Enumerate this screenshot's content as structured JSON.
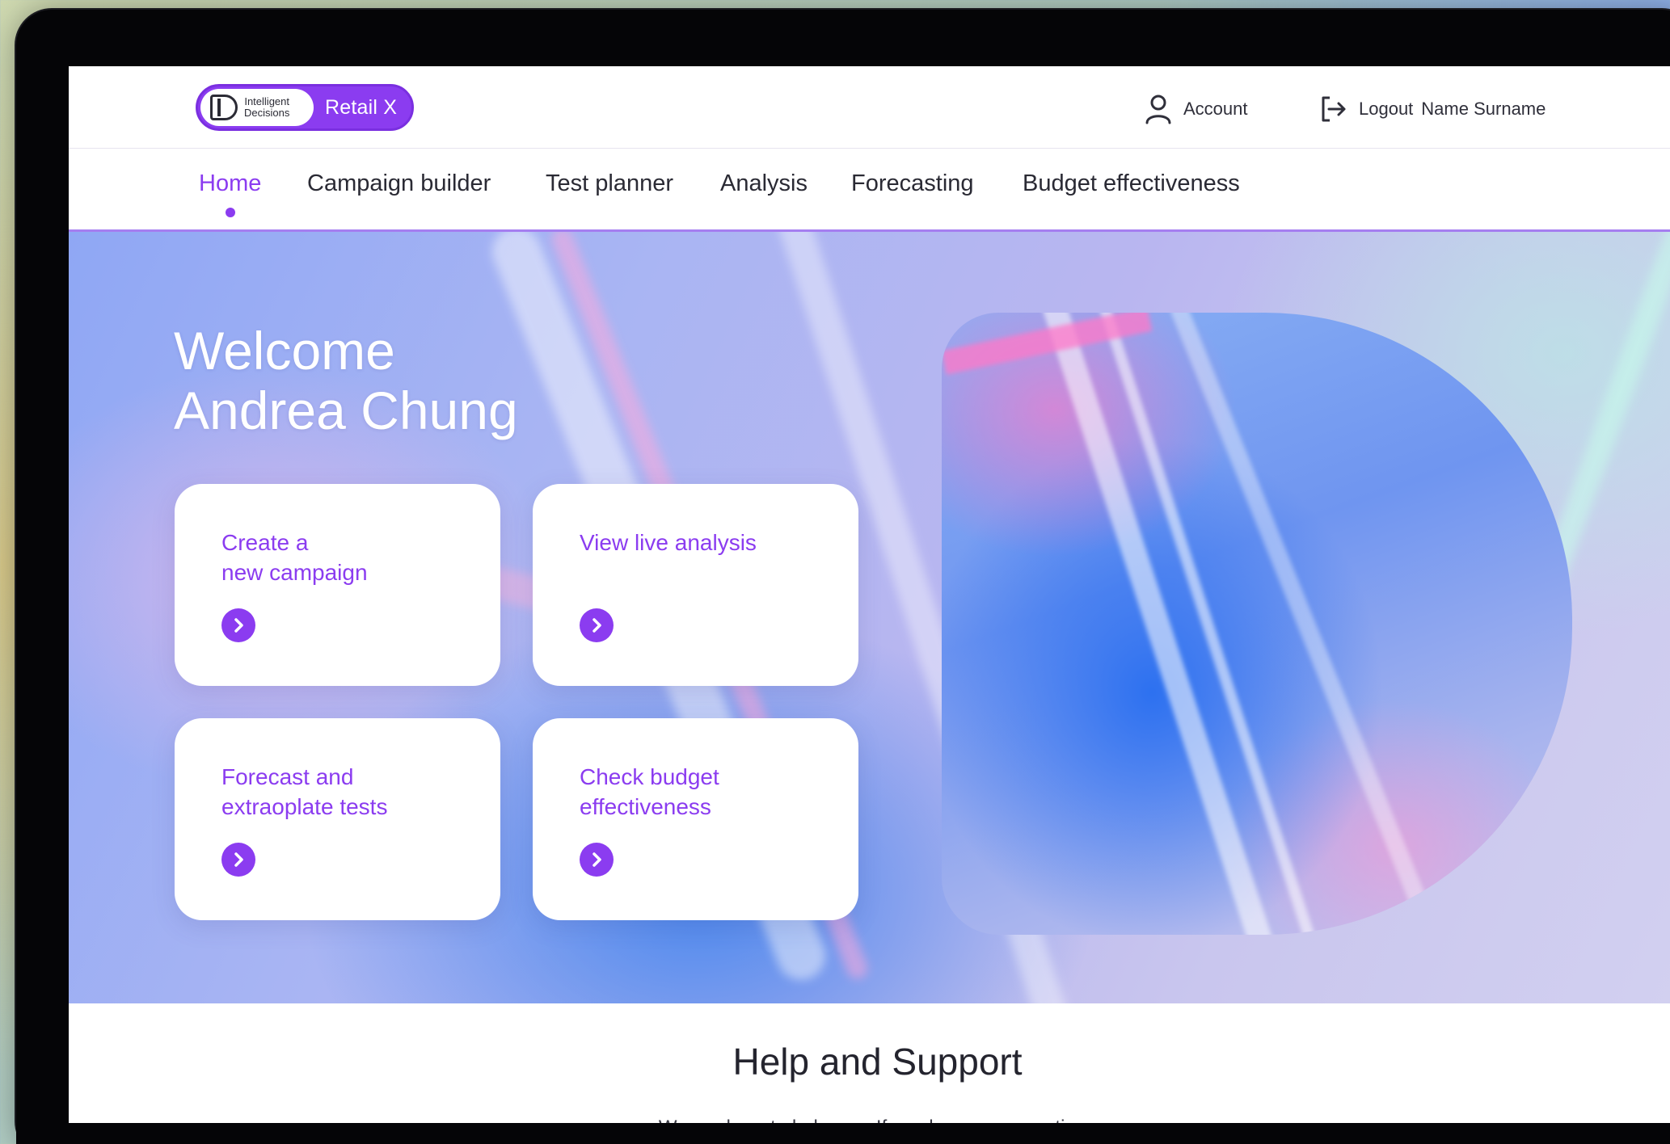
{
  "header": {
    "logo": {
      "brand_line1": "Intelligent",
      "brand_line2": "Decisions",
      "product": "Retail X"
    },
    "account_label": "Account",
    "logout_label": "Logout",
    "user_name": "Name Surname"
  },
  "nav": {
    "items": [
      {
        "label": "Home",
        "active": true
      },
      {
        "label": "Campaign builder",
        "active": false
      },
      {
        "label": "Test planner",
        "active": false
      },
      {
        "label": "Analysis",
        "active": false
      },
      {
        "label": "Forecasting",
        "active": false
      },
      {
        "label": "Budget effectiveness",
        "active": false
      }
    ]
  },
  "hero": {
    "welcome_line1": "Welcome",
    "welcome_line2": "Andrea Chung",
    "cards": [
      {
        "title": "Create a\nnew campaign"
      },
      {
        "title": "View live analysis"
      },
      {
        "title": "Forecast and\nextraoplate tests"
      },
      {
        "title": "Check budget\neffectiveness"
      }
    ]
  },
  "help": {
    "title": "Help and Support",
    "text": "We are here to help you. If you have any questions"
  },
  "colors": {
    "accent": "#8b3cf0",
    "text": "#2a2a34",
    "card": "#ffffff"
  }
}
